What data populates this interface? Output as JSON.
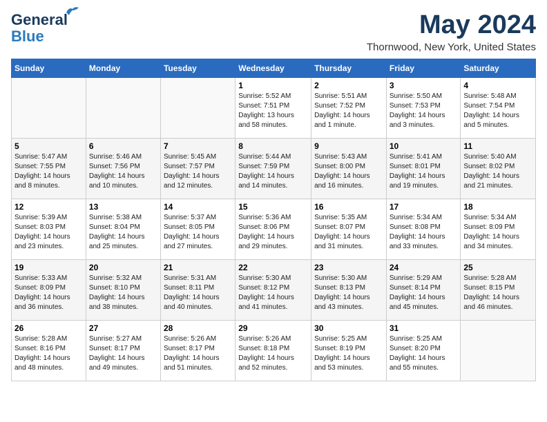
{
  "header": {
    "logo_line1": "General",
    "logo_line2": "Blue",
    "month": "May 2024",
    "location": "Thornwood, New York, United States"
  },
  "weekdays": [
    "Sunday",
    "Monday",
    "Tuesday",
    "Wednesday",
    "Thursday",
    "Friday",
    "Saturday"
  ],
  "weeks": [
    [
      {
        "day": "",
        "info": ""
      },
      {
        "day": "",
        "info": ""
      },
      {
        "day": "",
        "info": ""
      },
      {
        "day": "1",
        "info": "Sunrise: 5:52 AM\nSunset: 7:51 PM\nDaylight: 13 hours\nand 58 minutes."
      },
      {
        "day": "2",
        "info": "Sunrise: 5:51 AM\nSunset: 7:52 PM\nDaylight: 14 hours\nand 1 minute."
      },
      {
        "day": "3",
        "info": "Sunrise: 5:50 AM\nSunset: 7:53 PM\nDaylight: 14 hours\nand 3 minutes."
      },
      {
        "day": "4",
        "info": "Sunrise: 5:48 AM\nSunset: 7:54 PM\nDaylight: 14 hours\nand 5 minutes."
      }
    ],
    [
      {
        "day": "5",
        "info": "Sunrise: 5:47 AM\nSunset: 7:55 PM\nDaylight: 14 hours\nand 8 minutes."
      },
      {
        "day": "6",
        "info": "Sunrise: 5:46 AM\nSunset: 7:56 PM\nDaylight: 14 hours\nand 10 minutes."
      },
      {
        "day": "7",
        "info": "Sunrise: 5:45 AM\nSunset: 7:57 PM\nDaylight: 14 hours\nand 12 minutes."
      },
      {
        "day": "8",
        "info": "Sunrise: 5:44 AM\nSunset: 7:59 PM\nDaylight: 14 hours\nand 14 minutes."
      },
      {
        "day": "9",
        "info": "Sunrise: 5:43 AM\nSunset: 8:00 PM\nDaylight: 14 hours\nand 16 minutes."
      },
      {
        "day": "10",
        "info": "Sunrise: 5:41 AM\nSunset: 8:01 PM\nDaylight: 14 hours\nand 19 minutes."
      },
      {
        "day": "11",
        "info": "Sunrise: 5:40 AM\nSunset: 8:02 PM\nDaylight: 14 hours\nand 21 minutes."
      }
    ],
    [
      {
        "day": "12",
        "info": "Sunrise: 5:39 AM\nSunset: 8:03 PM\nDaylight: 14 hours\nand 23 minutes."
      },
      {
        "day": "13",
        "info": "Sunrise: 5:38 AM\nSunset: 8:04 PM\nDaylight: 14 hours\nand 25 minutes."
      },
      {
        "day": "14",
        "info": "Sunrise: 5:37 AM\nSunset: 8:05 PM\nDaylight: 14 hours\nand 27 minutes."
      },
      {
        "day": "15",
        "info": "Sunrise: 5:36 AM\nSunset: 8:06 PM\nDaylight: 14 hours\nand 29 minutes."
      },
      {
        "day": "16",
        "info": "Sunrise: 5:35 AM\nSunset: 8:07 PM\nDaylight: 14 hours\nand 31 minutes."
      },
      {
        "day": "17",
        "info": "Sunrise: 5:34 AM\nSunset: 8:08 PM\nDaylight: 14 hours\nand 33 minutes."
      },
      {
        "day": "18",
        "info": "Sunrise: 5:34 AM\nSunset: 8:09 PM\nDaylight: 14 hours\nand 34 minutes."
      }
    ],
    [
      {
        "day": "19",
        "info": "Sunrise: 5:33 AM\nSunset: 8:09 PM\nDaylight: 14 hours\nand 36 minutes."
      },
      {
        "day": "20",
        "info": "Sunrise: 5:32 AM\nSunset: 8:10 PM\nDaylight: 14 hours\nand 38 minutes."
      },
      {
        "day": "21",
        "info": "Sunrise: 5:31 AM\nSunset: 8:11 PM\nDaylight: 14 hours\nand 40 minutes."
      },
      {
        "day": "22",
        "info": "Sunrise: 5:30 AM\nSunset: 8:12 PM\nDaylight: 14 hours\nand 41 minutes."
      },
      {
        "day": "23",
        "info": "Sunrise: 5:30 AM\nSunset: 8:13 PM\nDaylight: 14 hours\nand 43 minutes."
      },
      {
        "day": "24",
        "info": "Sunrise: 5:29 AM\nSunset: 8:14 PM\nDaylight: 14 hours\nand 45 minutes."
      },
      {
        "day": "25",
        "info": "Sunrise: 5:28 AM\nSunset: 8:15 PM\nDaylight: 14 hours\nand 46 minutes."
      }
    ],
    [
      {
        "day": "26",
        "info": "Sunrise: 5:28 AM\nSunset: 8:16 PM\nDaylight: 14 hours\nand 48 minutes."
      },
      {
        "day": "27",
        "info": "Sunrise: 5:27 AM\nSunset: 8:17 PM\nDaylight: 14 hours\nand 49 minutes."
      },
      {
        "day": "28",
        "info": "Sunrise: 5:26 AM\nSunset: 8:17 PM\nDaylight: 14 hours\nand 51 minutes."
      },
      {
        "day": "29",
        "info": "Sunrise: 5:26 AM\nSunset: 8:18 PM\nDaylight: 14 hours\nand 52 minutes."
      },
      {
        "day": "30",
        "info": "Sunrise: 5:25 AM\nSunset: 8:19 PM\nDaylight: 14 hours\nand 53 minutes."
      },
      {
        "day": "31",
        "info": "Sunrise: 5:25 AM\nSunset: 8:20 PM\nDaylight: 14 hours\nand 55 minutes."
      },
      {
        "day": "",
        "info": ""
      }
    ]
  ]
}
